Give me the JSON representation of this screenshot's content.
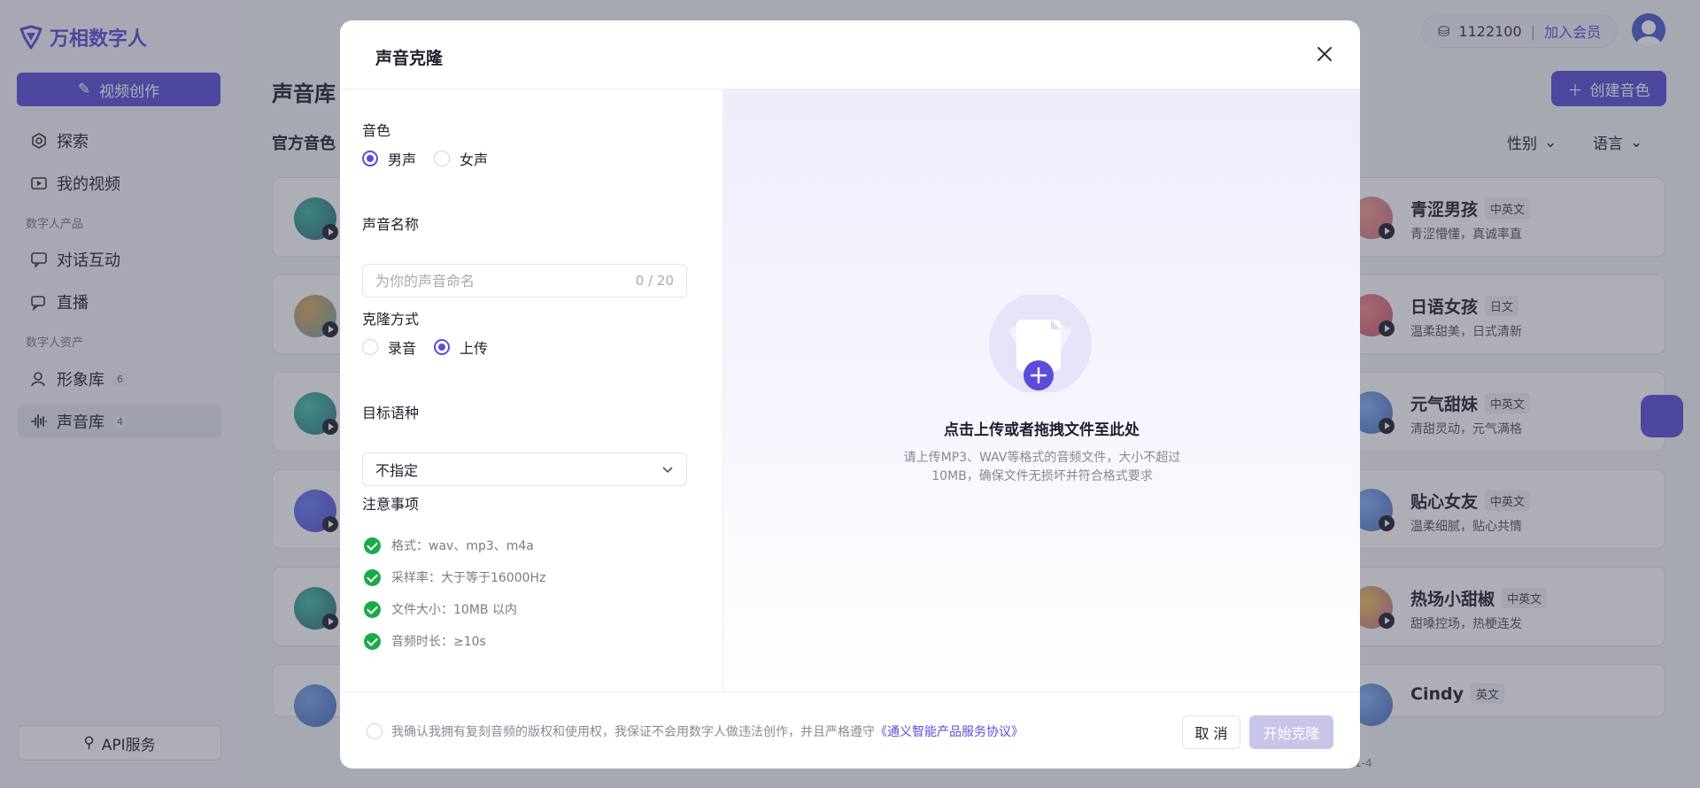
{
  "app": {
    "name": "万相数字人",
    "create_video": "视频创作",
    "nav": [
      {
        "label": "探索",
        "icon": "explore-icon"
      },
      {
        "label": "我的视频",
        "icon": "video-icon"
      }
    ],
    "group_products": "数字人产品",
    "nav_products": [
      {
        "label": "对话互动",
        "icon": "chat-icon"
      },
      {
        "label": "直播",
        "icon": "live-icon"
      }
    ],
    "group_assets": "数字人资产",
    "nav_assets": [
      {
        "label": "形象库",
        "badge": "6",
        "icon": "avatar-library-icon"
      },
      {
        "label": "声音库",
        "badge": "4",
        "icon": "voice-library-icon"
      }
    ],
    "api_service": "API服务"
  },
  "header": {
    "credits": "1122100",
    "separator": "|",
    "join_vip": "加入会员"
  },
  "main": {
    "title": "声音库",
    "subtitle": "官方音色",
    "create_voice": "创建音色",
    "filter_gender": "性别",
    "filter_language": "语言",
    "voices": [
      {
        "name": "青涩男孩",
        "tag": "中英文",
        "desc": "青涩懵懂，真诚率直"
      },
      {
        "name": "日语女孩",
        "tag": "日文",
        "desc": "温柔甜美，日式清新"
      },
      {
        "name": "元气甜妹",
        "tag": "中英文",
        "desc": "清甜灵动，元气满格"
      },
      {
        "name": "贴心女友",
        "tag": "中英文",
        "desc": "温柔细腻，贴心共情"
      },
      {
        "name": "热场小甜椒",
        "tag": "中英文",
        "desc": "甜嗓控场，热梗连发"
      },
      {
        "name": "Cindy",
        "tag": "英文",
        "desc": ""
      }
    ],
    "footer_text": "1-4"
  },
  "modal": {
    "title": "声音克隆",
    "timbre_label": "音色",
    "timbre_options": [
      "男声",
      "女声"
    ],
    "timbre_selected": "男声",
    "voice_name_label": "声音名称",
    "voice_name_placeholder": "为你的声音命名",
    "voice_name_value": "",
    "voice_name_counter": "0 / 20",
    "clone_method_label": "克隆方式",
    "clone_method_options": [
      "录音",
      "上传"
    ],
    "clone_method_selected": "上传",
    "target_language_label": "目标语种",
    "target_language_value": "不指定",
    "notes_label": "注意事项",
    "notes": [
      "格式：wav、mp3、m4a",
      "采样率：大于等于16000Hz",
      "文件大小：10MB 以内",
      "音频时长：≥10s"
    ],
    "upload_title": "点击上传或者拖拽文件至此处",
    "upload_desc": "请上传MP3、WAV等格式的音频文件，大小不超过10MB，确保文件无损坏并符合格式要求",
    "agreement_text": "我确认我拥有复刻音频的版权和使用权，我保证不会用数字人做违法创作，并且严格遵守",
    "agreement_link": "《通义智能产品服务协议》",
    "cancel": "取 消",
    "start": "开始克隆"
  },
  "colors": {
    "accent": "#5a4ed8",
    "check": "#1aab48",
    "disabled_button": "#c7c5e8"
  }
}
